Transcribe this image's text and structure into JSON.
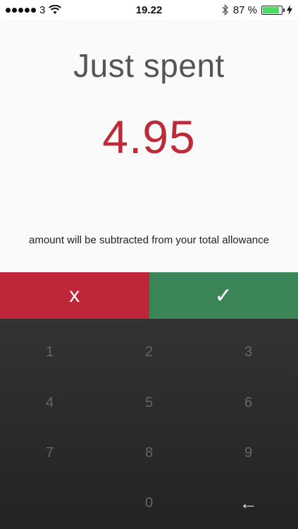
{
  "status_bar": {
    "carrier": "3",
    "time": "19.22",
    "battery_percent": "87 %",
    "battery_level": 0.87,
    "icons": [
      "signal-icon",
      "wifi-icon",
      "bluetooth-icon",
      "battery-icon",
      "charging-icon"
    ]
  },
  "screen": {
    "title": "Just spent",
    "amount": "4.95",
    "note": "amount will be subtracted from your total allowance"
  },
  "actions": {
    "cancel_label": "x",
    "confirm_label": "✓"
  },
  "keypad": {
    "keys": [
      "1",
      "2",
      "3",
      "4",
      "5",
      "6",
      "7",
      "8",
      "9",
      "0"
    ],
    "backspace": "←"
  },
  "colors": {
    "amount": "#bd2a3a",
    "cancel": "#c0263a",
    "confirm": "#3c8558",
    "keypad_bg": "#2b2b2b"
  }
}
